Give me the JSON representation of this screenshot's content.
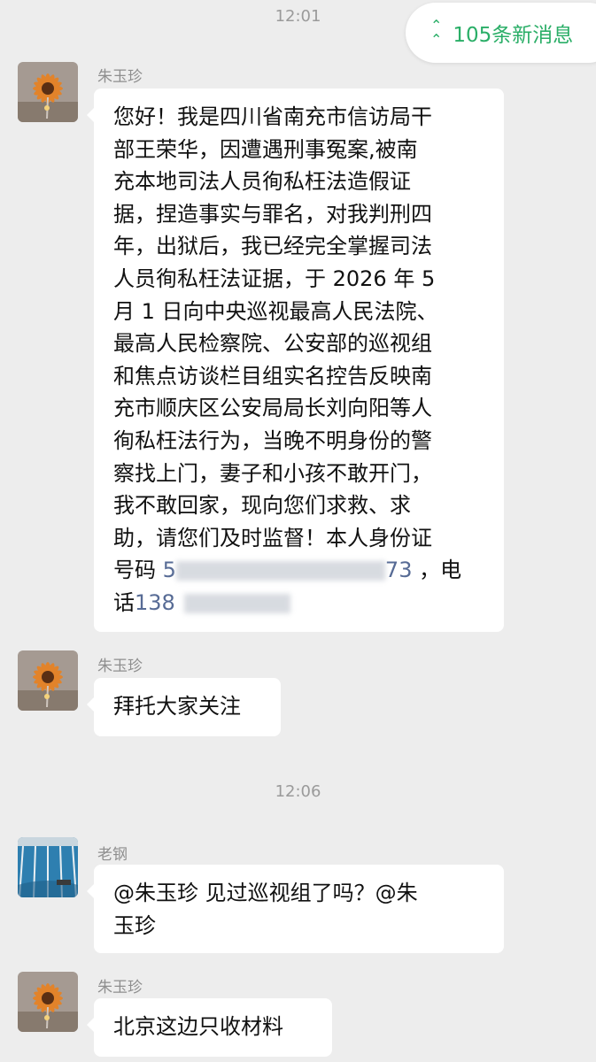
{
  "timestamps": [
    "12:01",
    "12:06"
  ],
  "new_messages_label": "105条新消息",
  "messages": [
    {
      "sender": "朱玉珍",
      "lines": [
        "您好！我是四川省南充市信访局干",
        "部王荣华，因遭遇刑事冤案,被南",
        "充本地司法人员徇私枉法造假证",
        "据，捏造事实与罪名，对我判刑四",
        "年，出狱后，我已经完全掌握司法",
        "人员徇私枉法证据，于 2026 年 5",
        "月 1 日向中央巡视最高人民法院、",
        "最高人民检察院、公安部的巡视组",
        "和焦点访谈栏目组实名控告反映南",
        "充市顺庆区公安局局长刘向阳等人",
        "徇私枉法行为，当晚不明身份的警",
        "察找上门，妻子和小孩不敢开门，",
        "我不敢回家，现向您们求救、求",
        "助，请您们及时监督！本人身份证"
      ],
      "id_label": "号码",
      "id_visible_start": "5",
      "id_visible_end": "73",
      "id_suffix": "，电",
      "phone_label": "话",
      "phone_visible": "138"
    },
    {
      "sender": "朱玉珍",
      "text": "拜托大家关注"
    },
    {
      "sender": "老钢",
      "lines": [
        "@朱玉珍  见过巡视组了吗？@朱",
        "玉珍"
      ]
    },
    {
      "sender": "朱玉珍",
      "text": "北京这边只收材料"
    }
  ],
  "colors": {
    "background": "#ededed",
    "bubble": "#ffffff",
    "accent_green": "#2aae67",
    "link_blue": "#576b95"
  },
  "icons": {
    "new_messages": "double-chevron-up-icon",
    "avatar_1": "sunflower-avatar",
    "avatar_2": "swimming-pool-avatar"
  }
}
